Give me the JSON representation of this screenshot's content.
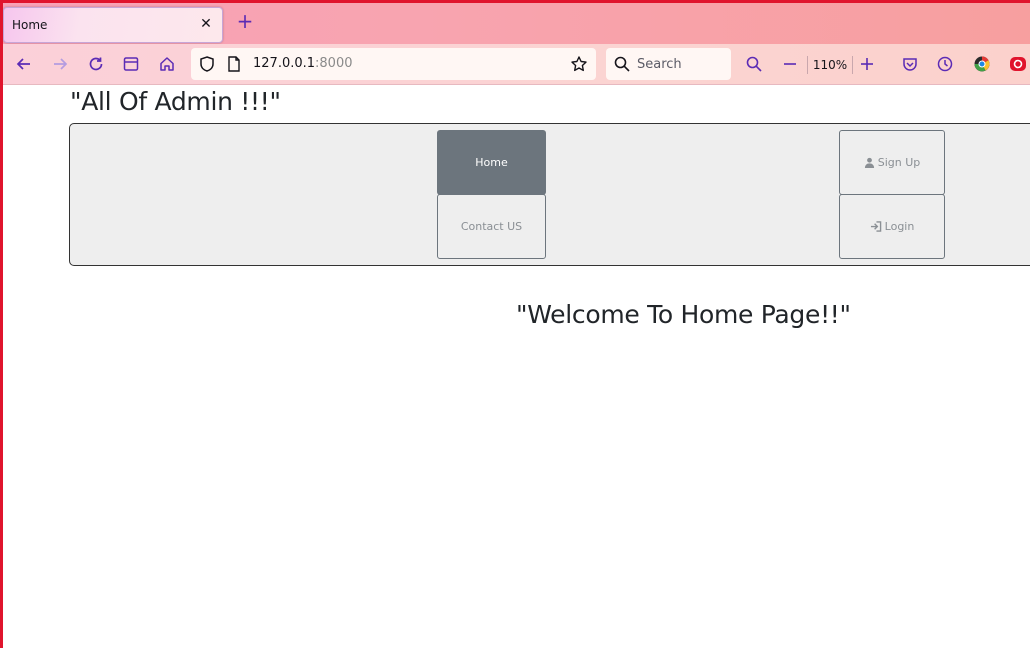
{
  "browser": {
    "tab": {
      "title": "Home"
    },
    "url": {
      "host": "127.0.0.1",
      "port": ":8000"
    },
    "search": {
      "placeholder": "Search"
    },
    "zoom": "110%",
    "accent_color": "#5b2bb5"
  },
  "page": {
    "heading": "\"All Of Admin !!!\"",
    "nav": {
      "home_label": "Home",
      "contact_label": "Contact US",
      "signup_label": "Sign Up",
      "login_label": "Login",
      "signup_icon": "user-icon",
      "login_icon": "login-icon"
    },
    "welcome": "\"Welcome To Home Page!!\""
  }
}
